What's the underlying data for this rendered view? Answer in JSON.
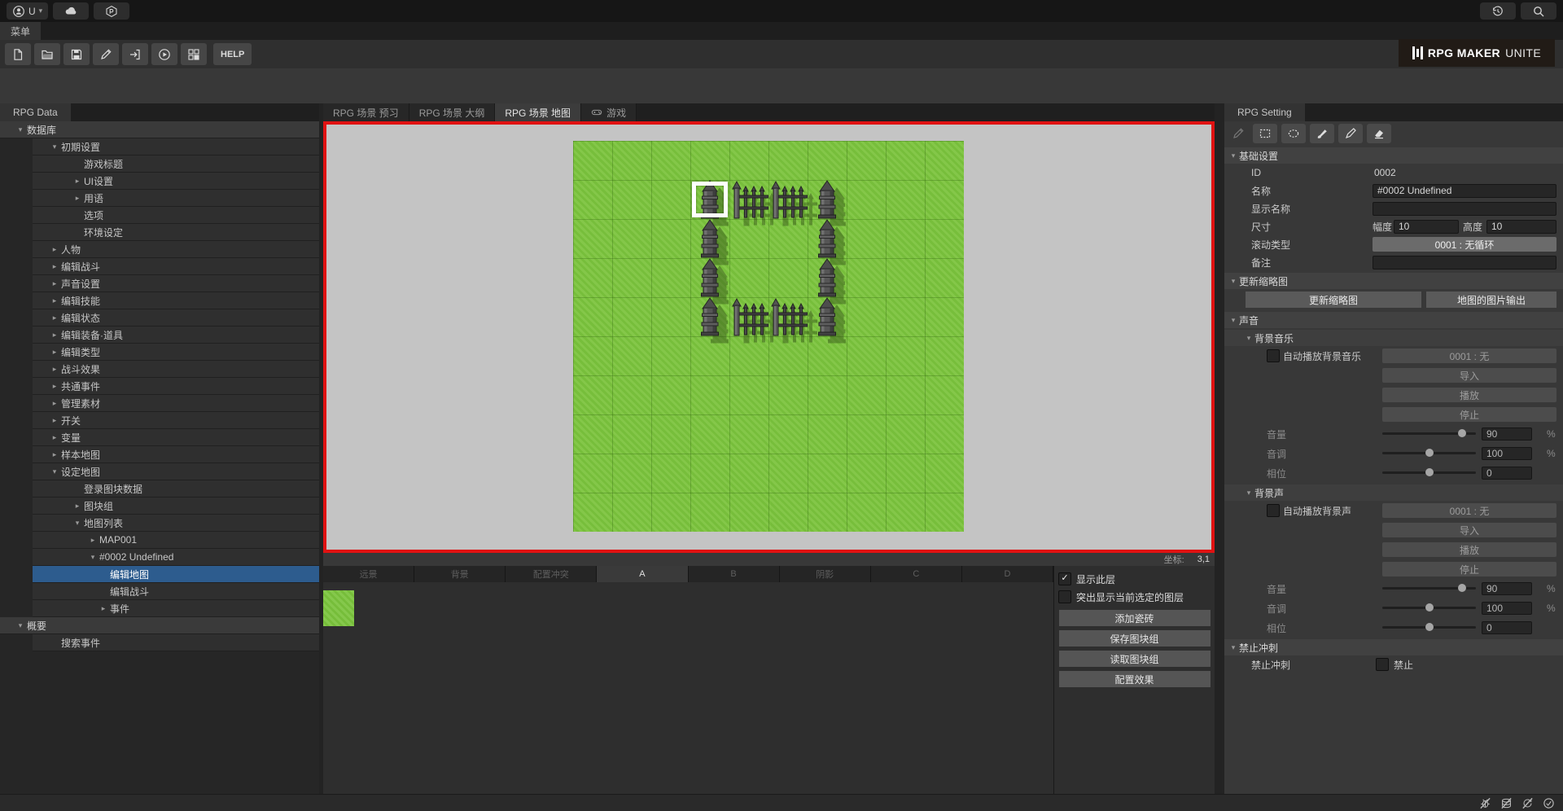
{
  "colors": {
    "accent_red": "#e01212",
    "selection_blue": "#2d5c8e",
    "grass_green": "#7cc43e"
  },
  "top_bar": {
    "account_label": "U"
  },
  "menu_bar": {
    "tab": "菜单"
  },
  "main_toolbar": {
    "items": [
      {
        "icon": "new-file"
      },
      {
        "icon": "open-folder"
      },
      {
        "icon": "save"
      },
      {
        "icon": "edit-pencil"
      },
      {
        "icon": "import"
      },
      {
        "icon": "play"
      },
      {
        "icon": "tile-manager"
      }
    ],
    "help_label": "HELP"
  },
  "logo": {
    "title": "RPG MAKER",
    "suffix": "UNITE"
  },
  "left_panel": {
    "tab": "RPG Data",
    "tree": [
      {
        "label": "数据库",
        "indent": 0,
        "arrow": "open",
        "header": true
      },
      {
        "label": "初期设置",
        "indent": 1,
        "arrow": "open"
      },
      {
        "label": "游戏标题",
        "indent": 2,
        "arrow": "none"
      },
      {
        "label": "UI设置",
        "indent": 2,
        "arrow": "closed"
      },
      {
        "label": "用语",
        "indent": 2,
        "arrow": "closed"
      },
      {
        "label": "选项",
        "indent": 2,
        "arrow": "none"
      },
      {
        "label": "环境设定",
        "indent": 2,
        "arrow": "none"
      },
      {
        "label": "人物",
        "indent": 1,
        "arrow": "closed"
      },
      {
        "label": "编辑战斗",
        "indent": 1,
        "arrow": "closed"
      },
      {
        "label": "声音设置",
        "indent": 1,
        "arrow": "closed"
      },
      {
        "label": "编辑技能",
        "indent": 1,
        "arrow": "closed"
      },
      {
        "label": "编辑状态",
        "indent": 1,
        "arrow": "closed"
      },
      {
        "label": "编辑装备·道具",
        "indent": 1,
        "arrow": "closed"
      },
      {
        "label": "编辑类型",
        "indent": 1,
        "arrow": "closed"
      },
      {
        "label": "战斗效果",
        "indent": 1,
        "arrow": "closed"
      },
      {
        "label": "共通事件",
        "indent": 1,
        "arrow": "closed"
      },
      {
        "label": "管理素材",
        "indent": 1,
        "arrow": "closed"
      },
      {
        "label": "开关",
        "indent": 1,
        "arrow": "closed"
      },
      {
        "label": "变量",
        "indent": 1,
        "arrow": "closed"
      },
      {
        "label": "样本地图",
        "indent": 1,
        "arrow": "closed"
      },
      {
        "label": "设定地图",
        "indent": 1,
        "arrow": "open"
      },
      {
        "label": "登录图块数据",
        "indent": 2,
        "arrow": "none"
      },
      {
        "label": "图块组",
        "indent": 2,
        "arrow": "closed"
      },
      {
        "label": "地图列表",
        "indent": 2,
        "arrow": "open"
      },
      {
        "label": "MAP001",
        "indent": 3,
        "arrow": "closed"
      },
      {
        "label": "#0002 Undefined",
        "indent": 3,
        "arrow": "open"
      },
      {
        "label": "编辑地图",
        "indent": 4,
        "arrow": "none",
        "selected": true
      },
      {
        "label": "编辑战斗",
        "indent": 4,
        "arrow": "none"
      },
      {
        "label": "事件",
        "indent": 4,
        "arrow": "closed"
      },
      {
        "label": "概要",
        "indent": 0,
        "arrow": "open",
        "header": true
      },
      {
        "label": "搜索事件",
        "indent": 1,
        "arrow": "none"
      }
    ]
  },
  "center": {
    "tabs": [
      {
        "label": "RPG 场景 预习"
      },
      {
        "label": "RPG 场景 大纲"
      },
      {
        "label": "RPG 场景 地图",
        "active": true
      },
      {
        "label": "游戏",
        "icon": "gamepad"
      }
    ],
    "map": {
      "cols": 10,
      "rows": 10,
      "cursor": {
        "col": 3,
        "row": 1
      },
      "wall_tiles": [
        {
          "col": 3,
          "row": 1,
          "type": "tower"
        },
        {
          "col": 4,
          "row": 1,
          "type": "fence"
        },
        {
          "col": 5,
          "row": 1,
          "type": "fence"
        },
        {
          "col": 6,
          "row": 1,
          "type": "tower"
        },
        {
          "col": 3,
          "row": 2,
          "type": "tower"
        },
        {
          "col": 6,
          "row": 2,
          "type": "tower"
        },
        {
          "col": 3,
          "row": 3,
          "type": "tower"
        },
        {
          "col": 6,
          "row": 3,
          "type": "tower"
        },
        {
          "col": 3,
          "row": 4,
          "type": "tower"
        },
        {
          "col": 4,
          "row": 4,
          "type": "fence"
        },
        {
          "col": 5,
          "row": 4,
          "type": "fence"
        },
        {
          "col": 6,
          "row": 4,
          "type": "tower"
        }
      ]
    },
    "coord_label": "坐标:",
    "coord_value": "3,1"
  },
  "layer_bar": {
    "tabs": [
      "远景",
      "背景",
      "配置冲突",
      "A",
      "B",
      "阴影",
      "C",
      "D"
    ],
    "active": "A"
  },
  "layer_controls": {
    "show_layer_label": "显示此层",
    "show_layer_checked": true,
    "highlight_label": "突出显示当前选定的图层",
    "highlight_checked": false,
    "buttons": [
      "添加瓷砖",
      "保存图块组",
      "读取图块组",
      "配置效果"
    ]
  },
  "right_panel": {
    "tab": "RPG Setting",
    "tools": [
      "pencil",
      "rect-select",
      "ellipse-select",
      "brush",
      "pen",
      "eraser"
    ],
    "basic": {
      "header": "基础设置",
      "id_label": "ID",
      "id_value": "0002",
      "name_label": "名称",
      "name_value": "#0002 Undefined",
      "display_label": "显示名称",
      "display_value": "",
      "size_label": "尺寸",
      "width_label": "幅度",
      "width_value": "10",
      "height_label": "高度",
      "height_value": "10",
      "scroll_label": "滚动类型",
      "scroll_value": "0001 : 无循环",
      "note_label": "备注",
      "note_value": ""
    },
    "thumbnail": {
      "header": "更新缩略图",
      "update_label": "更新缩略图",
      "export_label": "地图的图片输出"
    },
    "sound": {
      "header": "声音",
      "groups": [
        {
          "key": "bgm",
          "header": "背景音乐",
          "auto_label": "自动播放背景音乐",
          "auto_checked": false,
          "select_value": "0001 : 无",
          "import_label": "导入",
          "play_label": "播放",
          "stop_label": "停止",
          "sliders": [
            {
              "key": "volume",
              "label": "音量",
              "value": "90",
              "unit": "%",
              "pct": 85
            },
            {
              "key": "pitch",
              "label": "音调",
              "value": "100",
              "unit": "%",
              "pct": 50
            },
            {
              "key": "pan",
              "label": "相位",
              "value": "0",
              "unit": "",
              "pct": 50
            }
          ]
        },
        {
          "key": "bgs",
          "header": "背景声",
          "auto_label": "自动播放背景声",
          "auto_checked": false,
          "select_value": "0001 : 无",
          "import_label": "导入",
          "play_label": "播放",
          "stop_label": "停止",
          "sliders": [
            {
              "key": "volume",
              "label": "音量",
              "value": "90",
              "unit": "%",
              "pct": 85
            },
            {
              "key": "pitch",
              "label": "音调",
              "value": "100",
              "unit": "%",
              "pct": 50
            },
            {
              "key": "pan",
              "label": "相位",
              "value": "0",
              "unit": "",
              "pct": 50
            }
          ]
        }
      ]
    },
    "dash": {
      "header": "禁止冲刺",
      "row_label": "禁止冲刺",
      "checkbox_label": "禁止",
      "checked": false
    }
  },
  "status_bar": {
    "icons": [
      "bug-off",
      "layers-off",
      "refresh-off",
      "check-circle"
    ]
  }
}
